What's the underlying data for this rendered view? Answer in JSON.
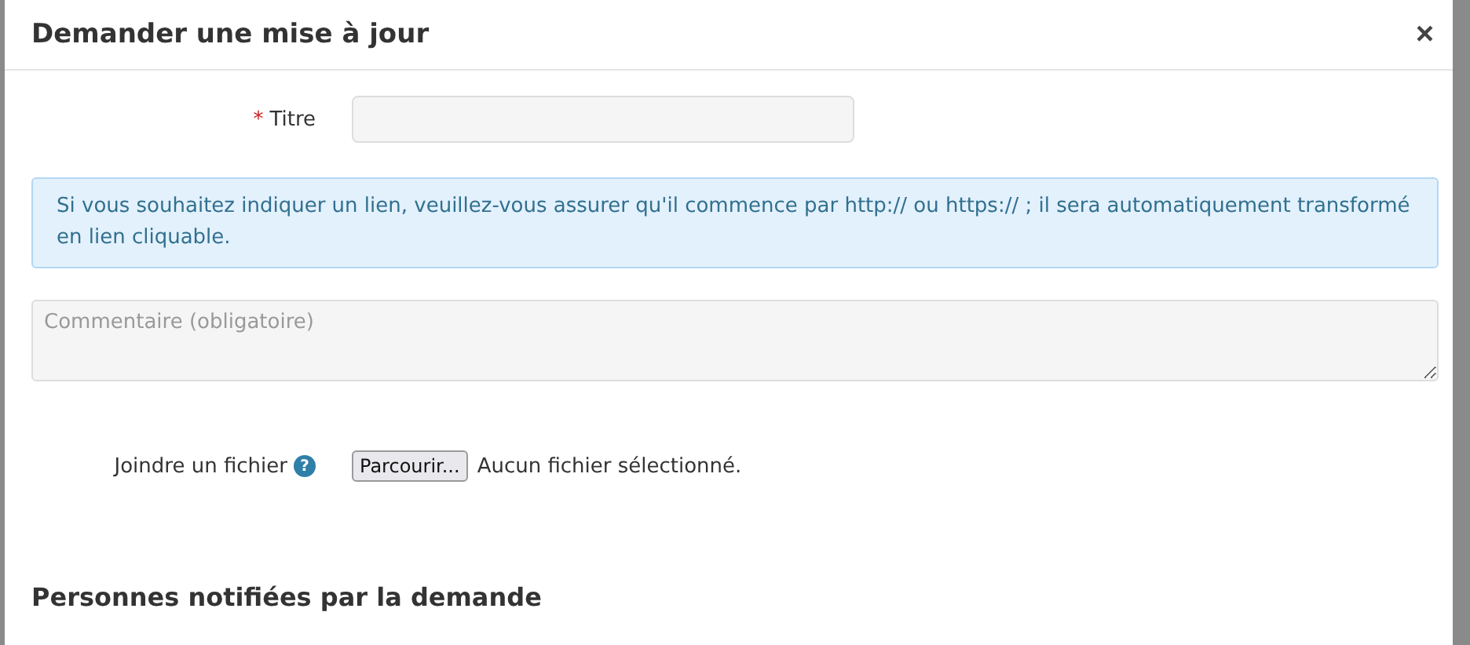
{
  "dialog": {
    "title": "Demander une mise à jour",
    "close": "×"
  },
  "title_field": {
    "label": "Titre",
    "required_mark": "*"
  },
  "info": "Si vous souhaitez indiquer un lien, veuillez-vous assurer qu'il commence par http:// ou https:// ; il sera automatiquement transformé en lien cliquable.",
  "comment": {
    "placeholder": "Commentaire (obligatoire)"
  },
  "attachment": {
    "label": "Joindre un fichier",
    "help": "?",
    "button": "Parcourir...",
    "status": "Aucun fichier sélectionné."
  },
  "section_heading": "Personnes notifiées par la demande"
}
